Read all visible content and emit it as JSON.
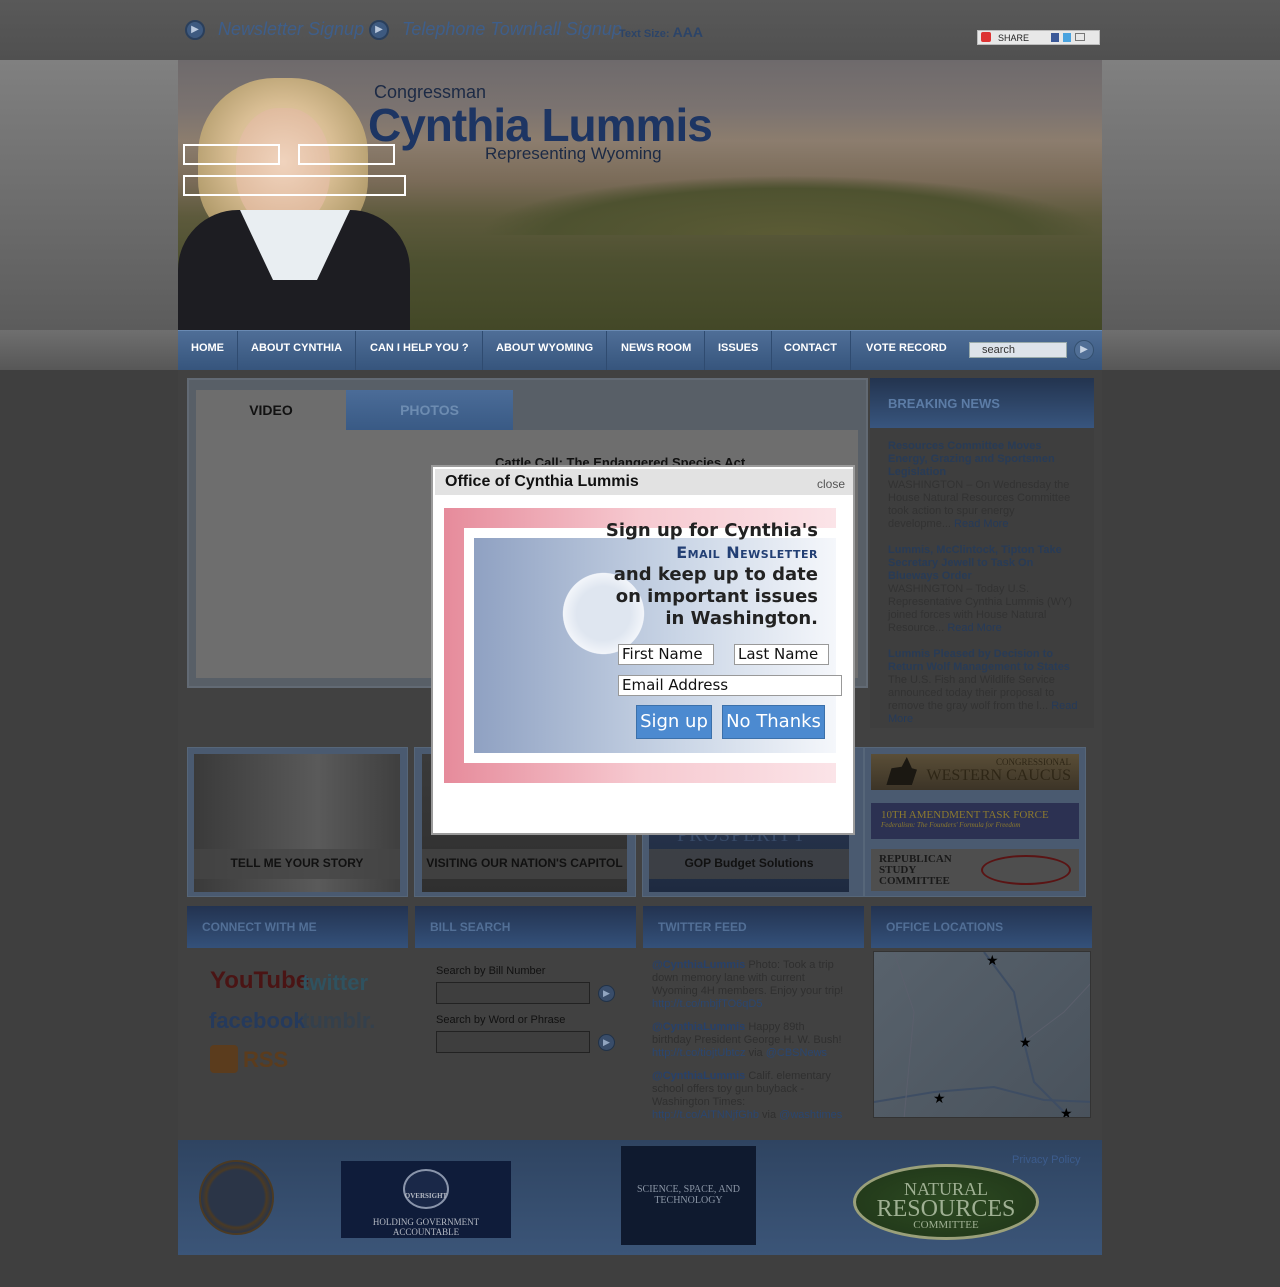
{
  "topbar": {
    "newsletter_link": "Newsletter Signup",
    "townhall_link": "Telephone Townhall Signup",
    "text_size_label": "Text Size:",
    "text_size_letters": "AAA",
    "share_label": "SHARE"
  },
  "header": {
    "congressman": "Congressman",
    "name": "Cynthia Lummis",
    "representing": "Representing Wyoming"
  },
  "nav": {
    "items": [
      "HOME",
      "ABOUT CYNTHIA",
      "CAN I HELP YOU ?",
      "ABOUT WYOMING",
      "NEWS ROOM",
      "ISSUES",
      "CONTACT",
      "VOTE RECORD"
    ],
    "search_placeholder": "search"
  },
  "media": {
    "tab_video": "VIDEO",
    "tab_photos": "PHOTOS",
    "video_title": "Cattle Call: The Endangered Species Act"
  },
  "breaking_news": {
    "heading": "BREAKING NEWS",
    "read_more": "Read More",
    "items": [
      {
        "title": "Resources Committee Moves Energy, Grazing and Sportsmen Legislation",
        "summary": "WASHINGTON – On Wednesday the House Natural Resources Committee took action to spur energy developme..."
      },
      {
        "title": "Lummis, McClintock, Tipton Take Secretary Jewell to Task On Blueways Order",
        "summary": "WASHINGTON – Today U.S. Representative Cynthia Lummis (WY) joined forces with House Natural Resource..."
      },
      {
        "title": "Lummis Pleased by Decision to Return Wolf Management to States",
        "summary": "The U.S. Fish and Wildlife Service announced today their proposal to remove the gray wolf from the l..."
      }
    ]
  },
  "promos": {
    "story": "TELL ME YOUR STORY",
    "capitol": "VISITING OUR NATION'S CAPITOL",
    "budget": "GOP Budget Solutions",
    "budget_banner": "PROSPERITY",
    "caucus_small": "CONGRESSIONAL",
    "caucus": "WESTERN CAUCUS",
    "tenth": "10TH AMENDMENT TASK FORCE",
    "tenth_sub": "Federalism: The Founders' Formula for Freedom",
    "rsc_1": "REPUBLICAN",
    "rsc_2": "STUDY",
    "rsc_3": "COMMITTEE"
  },
  "connect": {
    "heading": "CONNECT WITH ME",
    "youtube": "YouTube",
    "twitter": "twitter",
    "facebook": "facebook",
    "tumblr": "tumblr.",
    "rss": "RSS"
  },
  "bill_search": {
    "heading": "BILL SEARCH",
    "by_number": "Search by Bill Number",
    "by_word": "Search by Word or Phrase"
  },
  "twitter_feed": {
    "heading": "TWITTER FEED",
    "tweets": [
      {
        "handle": "@CynthiaLummis",
        "text": "Photo: Took a trip down memory lane with current Wyoming 4H members. Enjoy your trip!",
        "link": "http://t.co/mbjfTO6qD5",
        "via": ""
      },
      {
        "handle": "@CynthiaLummis",
        "text": "Happy 89th birthday President George H. W. Bush!",
        "link": "http://t.co/tiojtUbtcz",
        "via": "@CBSNews"
      },
      {
        "handle": "@CynthiaLummis",
        "text": "Calif. elementary school offers toy gun buyback - Washington Times:",
        "link": "http://t.co/AlTNNjfGhb",
        "via": "@washtimes"
      }
    ],
    "via_word": "via"
  },
  "office_locations": {
    "heading": "OFFICE LOCATIONS"
  },
  "footer": {
    "privacy": "Privacy Policy",
    "oversight_top": "OVERSIGHT",
    "oversight_tagline": "HOLDING GOVERNMENT ACCOUNTABLE",
    "science": "SCIENCE, SPACE, AND TECHNOLOGY",
    "natres_1": "NATURAL",
    "natres_2": "RESOURCES",
    "natres_3": "COMMITTEE"
  },
  "modal": {
    "title": "Office of Cynthia Lummis",
    "close": "close",
    "line1": "Sign up for Cynthia's",
    "line2": "Email Newsletter",
    "line3": "and keep up to date",
    "line4": "on important issues",
    "line5": "in Washington.",
    "first_name": "First Name",
    "last_name": "Last Name",
    "email": "Email Address",
    "signup": "Sign up",
    "no_thanks": "No Thanks"
  }
}
